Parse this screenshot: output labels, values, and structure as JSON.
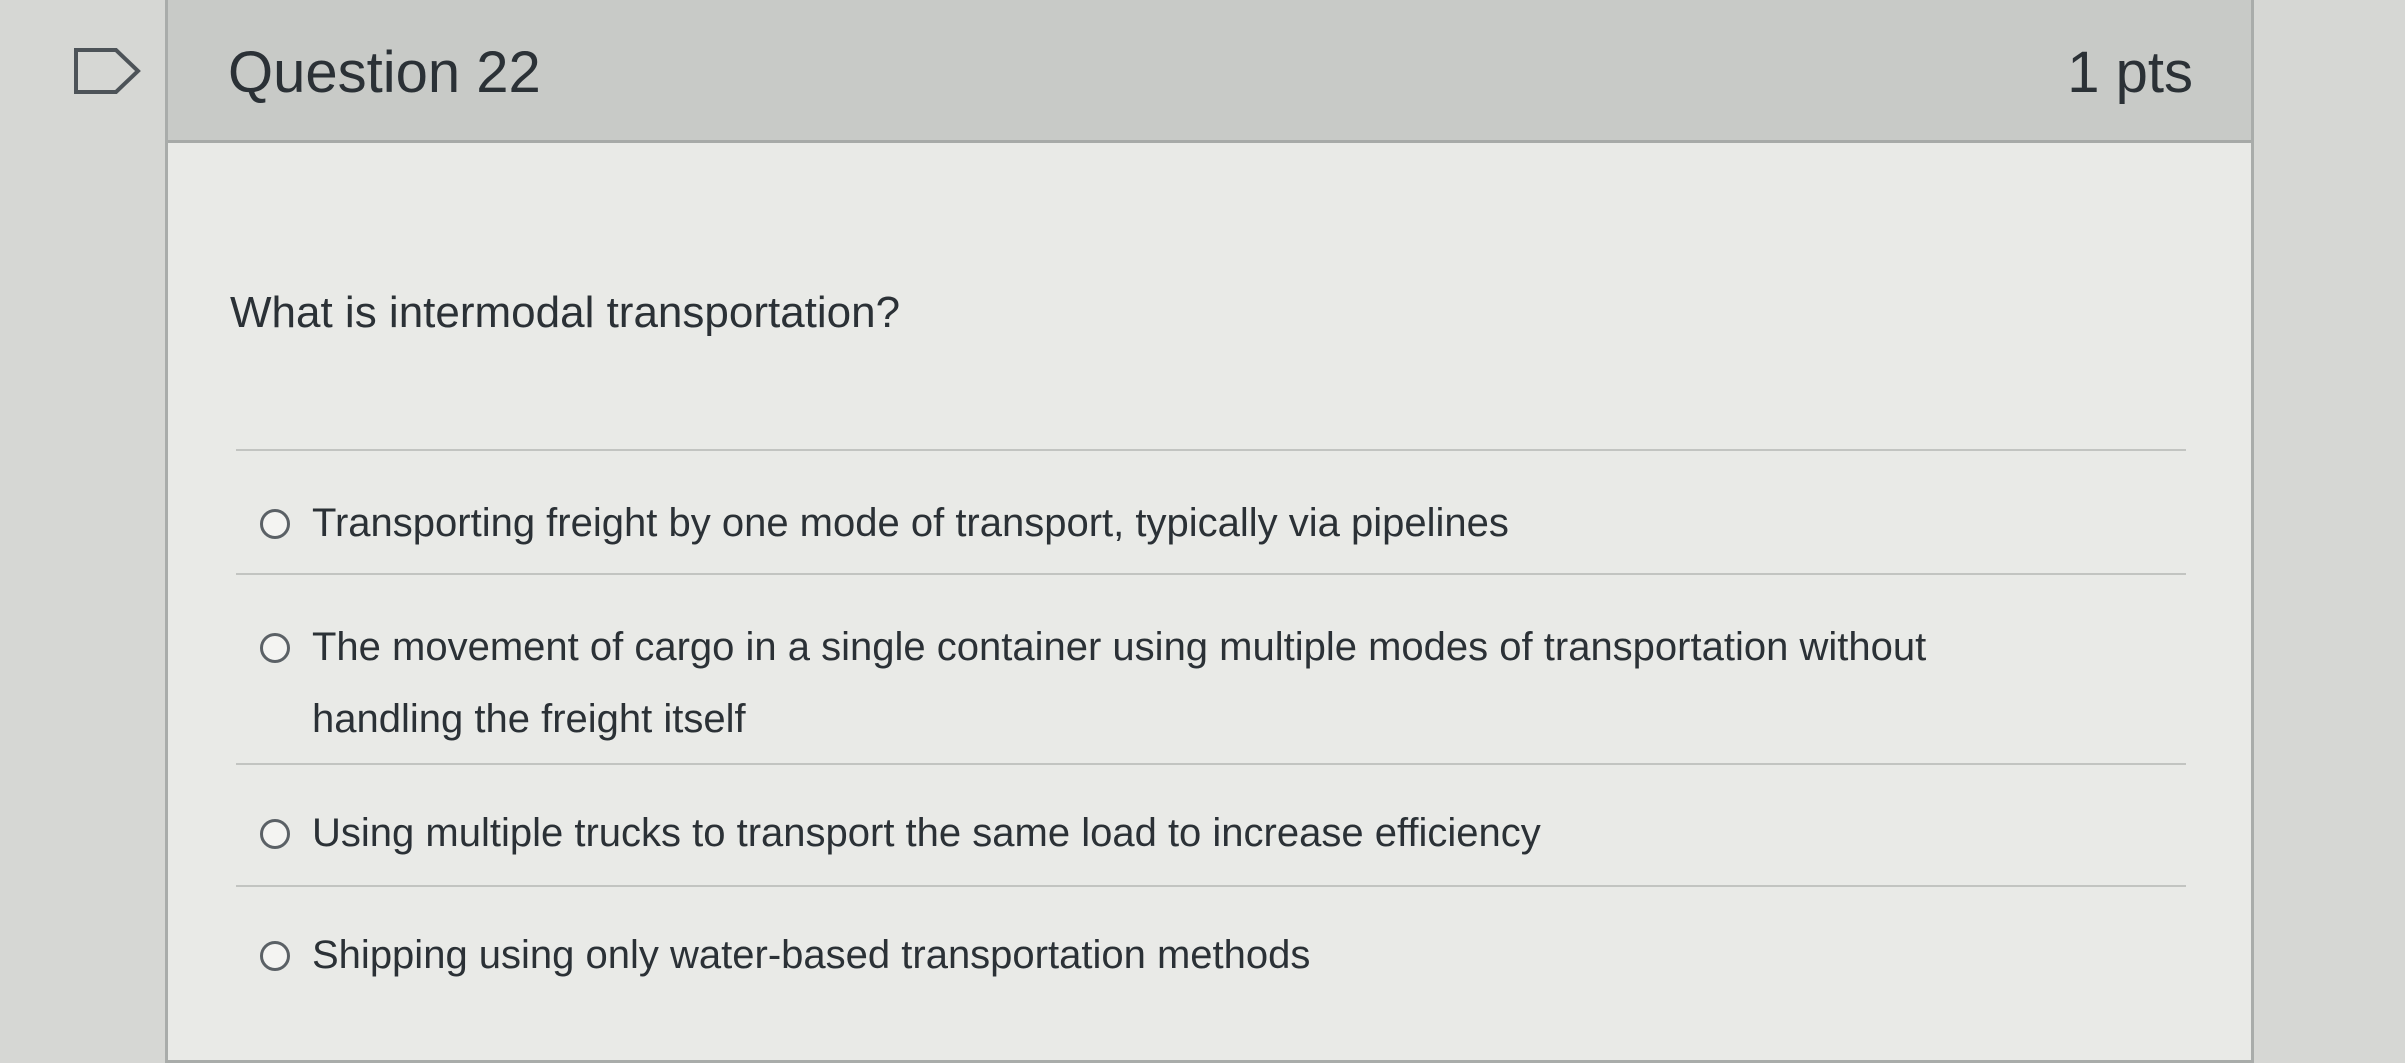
{
  "header": {
    "title": "Question 22",
    "points": "1 pts"
  },
  "question": {
    "text": "What is intermodal transportation?"
  },
  "answers": [
    {
      "label": "Transporting freight by one mode of transport, typically via pipelines",
      "selected": false
    },
    {
      "label": "The movement of cargo in a single container using multiple modes of transportation without handling the freight itself",
      "selected": false
    },
    {
      "label": "Using multiple trucks to transport the same load to increase efficiency",
      "selected": false
    },
    {
      "label": "Shipping using only water-based transportation methods",
      "selected": false
    }
  ],
  "icons": {
    "flag": "flag-question-icon",
    "radio": "radio-unchecked-icon"
  },
  "colors": {
    "header_bg": "#c8cac7",
    "body_bg": "#e9eae7",
    "text": "#2b3136"
  }
}
